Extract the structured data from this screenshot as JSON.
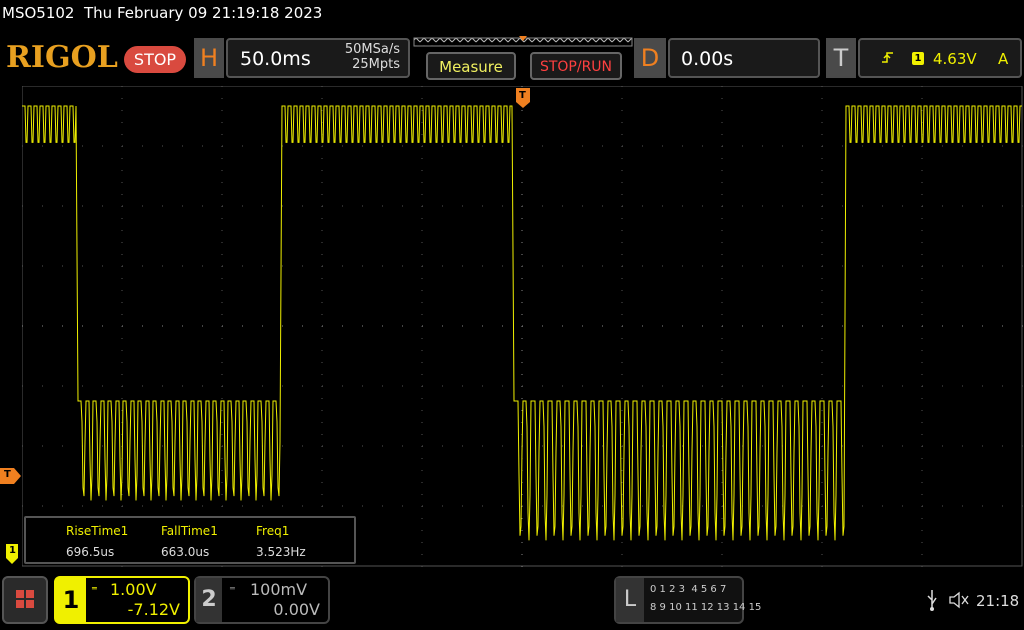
{
  "header": {
    "model": "MSO5102",
    "datetime": "Thu February 09 21:19:18 2023",
    "brand": "RIGOL",
    "run_state": "STOP"
  },
  "horizontal": {
    "key": "H",
    "timebase": "50.0ms",
    "sample_rate": "50MSa/s",
    "memory_depth": "25Mpts"
  },
  "buttons": {
    "measure": "Measure",
    "stop_run": "STOP/RUN"
  },
  "delay": {
    "key": "D",
    "value": "0.00s"
  },
  "trigger": {
    "key": "T",
    "source": "1",
    "level": "4.63V",
    "mode": "A"
  },
  "markers": {
    "trigger_position": "T",
    "trigger_level": "T",
    "ch1_ground": "1"
  },
  "measurements": {
    "headers": [
      "RiseTime1",
      "FallTime1",
      "Freq1"
    ],
    "values": [
      "696.5us",
      "663.0us",
      "3.523Hz"
    ]
  },
  "channel1": {
    "number": "1",
    "scale": "1.00V",
    "offset": "-7.12V"
  },
  "channel2": {
    "number": "2",
    "scale": "100mV",
    "offset": "0.00V"
  },
  "logic": {
    "key": "L",
    "row1": "0 1 2 3  4 5 6 7",
    "row2": "8 9 10 11 12 13 14 15"
  },
  "status": {
    "clock": "21:18"
  },
  "colors": {
    "ch1": "#f0f000",
    "accent": "#f08020",
    "stop": "#d94a3f",
    "grid": "#555555"
  },
  "icons": [
    "menu-icon",
    "usb-icon",
    "mute-icon",
    "trigger-edge-icon"
  ]
}
